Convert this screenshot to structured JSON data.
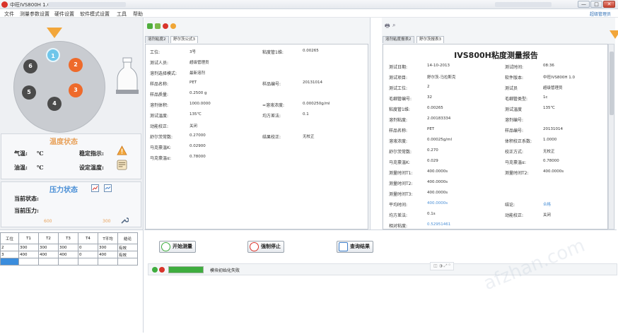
{
  "window": {
    "title": "中旺IVS800H 1.0",
    "controls": [
      "—",
      "□",
      "✕"
    ]
  },
  "menu": {
    "items": [
      "文件",
      "测量参数设置",
      "硬件设置",
      "软件模式设置",
      "工具",
      "帮助"
    ],
    "user": "超级管理员"
  },
  "left": {
    "positions": [
      {
        "label": "1",
        "color": "#6fc6ea"
      },
      {
        "label": "2",
        "color": "#ee6a2b"
      },
      {
        "label": "3",
        "color": "#ee6a2b"
      },
      {
        "label": "4",
        "color": "#4b4b4b"
      },
      {
        "label": "5",
        "color": "#4b4b4b"
      },
      {
        "label": "6",
        "color": "#4b4b4b"
      }
    ],
    "temp_section": {
      "title": "温度状态",
      "air_label": "气温:",
      "air_unit": "℃",
      "oil_label": "油温:",
      "oil_unit": "℃",
      "stable_label": "稳定指示:",
      "setpoint_label": "设定温度:"
    },
    "pressure_section": {
      "title": "压力状态",
      "current_state_label": "当前状态:",
      "current_pressure_label": "当前压力:",
      "scale_min": "600",
      "scale_max": "300"
    }
  },
  "table": {
    "headers": [
      "工位",
      "T1",
      "T2",
      "T3",
      "T4",
      "T平均",
      "结论"
    ],
    "rows": [
      [
        "2",
        "300",
        "300",
        "300",
        "0",
        "300",
        "有效"
      ],
      [
        "3",
        "400",
        "400",
        "400",
        "0",
        "400",
        "有效"
      ]
    ]
  },
  "middle": {
    "tabs": [
      "溶剂粘度2",
      "舒尔茨公式3"
    ],
    "fields": [
      {
        "k": "工位:",
        "v": "3号"
      },
      {
        "k": "测试人员:",
        "v": "超级管理员"
      },
      {
        "k": "溶剂选择模式:",
        "v": "最新溶剂"
      },
      {
        "k": "样品名称:",
        "v": "PET"
      },
      {
        "k": "样品质量:",
        "v": "0.2500  g"
      },
      {
        "k": "溶剂体积:",
        "v": "1000.0000"
      },
      {
        "k": "测试温度:",
        "v": "135℃"
      },
      {
        "k": "动能校正:",
        "v": "关闭"
      },
      {
        "k": "舒尔茨常数:",
        "v": "0.27000"
      },
      {
        "k": "马克豪温K:",
        "v": "0.02900"
      },
      {
        "k": "马克豪温α:",
        "v": "0.78000"
      }
    ],
    "fields_right": [
      {
        "k": "粘度管1维:",
        "v": "0.00265"
      },
      {
        "k": "样品编号:",
        "v": "20131014"
      },
      {
        "k": "=溶液浓度:",
        "v": "0.000250g/ml"
      },
      {
        "k": "均方差法:",
        "v": "0.1"
      },
      {
        "k": "结果校正:",
        "v": "无校正"
      }
    ]
  },
  "report": {
    "tabs": [
      "溶剂粘度报表2",
      "舒尔茨报表3"
    ],
    "title": "IVS800H粘度测量报告",
    "left": [
      {
        "k": "测试日期:",
        "v": "14-10-2013"
      },
      {
        "k": "测试项目:",
        "v": "舒尔茨-马拉斯克"
      },
      {
        "k": "测试工位:",
        "v": "2"
      },
      {
        "k": "毛细管编号:",
        "v": "32"
      },
      {
        "k": "粘度管1维:",
        "v": "0.00265"
      },
      {
        "k": "溶剂粘度:",
        "v": "2.00183334"
      },
      {
        "k": "样品名称:",
        "v": "PET"
      },
      {
        "k": "溶液浓度:",
        "v": "0.00025g/ml"
      },
      {
        "k": "舒尔茨常数:",
        "v": "0.270"
      },
      {
        "k": "马克豪温K:",
        "v": "0.029"
      },
      {
        "k": "测量时间T1:",
        "v": "400.0000s"
      },
      {
        "k": "测量时间T2:",
        "v": "400.0000s"
      },
      {
        "k": "测量时间T3:",
        "v": "400.0000s"
      },
      {
        "k": "平均时间:",
        "v": "400.0000s",
        "blue": true
      },
      {
        "k": "均方差法:",
        "v": "0.1s"
      },
      {
        "k": "相对粘度:",
        "v": "0.52951461",
        "blue": true
      }
    ],
    "right": [
      {
        "k": "测试时间:",
        "v": "08:36"
      },
      {
        "k": "软件版本:",
        "v": "中旺IVS800H 1.0"
      },
      {
        "k": "测试员",
        "v": "超级管理员"
      },
      {
        "k": "毛细管类型:",
        "v": "1c"
      },
      {
        "k": "测试温度",
        "v": "135℃"
      },
      {
        "k": "溶剂编号:",
        "v": ""
      },
      {
        "k": "样品编号:",
        "v": "20131014"
      },
      {
        "k": "体积校正系数:",
        "v": "1.0000"
      },
      {
        "k": "校正方式:",
        "v": "无校正"
      },
      {
        "k": "马克豪温α:",
        "v": "0.78000"
      },
      {
        "k": "测量时间T2:",
        "v": "400.0000s"
      },
      {
        "k": "",
        "v": ""
      },
      {
        "k": "",
        "v": ""
      },
      {
        "k": "结论:",
        "v": "合格",
        "blue": true
      },
      {
        "k": "动能校正:",
        "v": "关闭"
      },
      {
        "k": "",
        "v": ""
      }
    ]
  },
  "controls": {
    "start": "开始测量",
    "stop": "强制停止",
    "query": "查询结果"
  },
  "status": {
    "message": "模块初始化失败",
    "progress": 1.0,
    "zoom_controls": "◫ ◑ ⤢ ⁰"
  }
}
